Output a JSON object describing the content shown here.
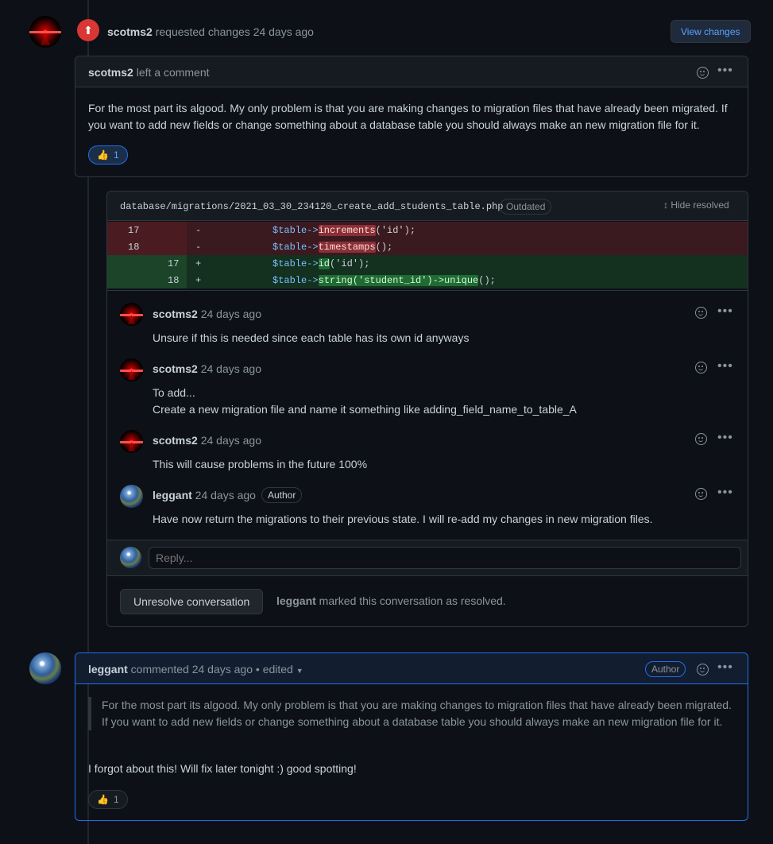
{
  "review": {
    "user": "scotms2",
    "action": "requested changes",
    "time": "24 days ago",
    "view_changes_label": "View changes",
    "comment_header_user": "scotms2",
    "comment_header_action": "left a comment",
    "body": "For the most part its algood. My only problem is that you are making changes to migration files that have already been migrated. If you want to add new fields or change something about a database table you should always make an new migration file for it.",
    "reaction_emoji": "👍",
    "reaction_count": "1"
  },
  "thread": {
    "file_path": "database/migrations/2021_03_30_234120_create_add_students_table.php",
    "outdated_label": "Outdated",
    "hide_resolved_label": "Hide resolved",
    "diff": [
      {
        "type": "del",
        "old": "17",
        "new": "",
        "sign": "-",
        "pre": "$table->",
        "hl": "increments",
        "post": "('id');"
      },
      {
        "type": "del",
        "old": "18",
        "new": "",
        "sign": "-",
        "pre": "$table->",
        "hl": "timestamps",
        "post": "();"
      },
      {
        "type": "add",
        "old": "",
        "new": "17",
        "sign": "+",
        "pre": "$table->",
        "hl": "id",
        "post": "('id');"
      },
      {
        "type": "add",
        "old": "",
        "new": "18",
        "sign": "+",
        "pre": "$table->",
        "hl": "string('student_id')->unique",
        "post": "();"
      }
    ],
    "comments": [
      {
        "user": "scotms2",
        "time": "24 days ago",
        "body": "Unsure if this is needed since each table has its own id anyways"
      },
      {
        "user": "scotms2",
        "time": "24 days ago",
        "body_line1": "To add...",
        "body_line2": "Create a new migration file and name it something like adding_field_name_to_table_A"
      },
      {
        "user": "scotms2",
        "time": "24 days ago",
        "body": "This will cause problems in the future 100%"
      },
      {
        "user": "leggant",
        "time": "24 days ago",
        "badge": "Author",
        "body": "Have now return the migrations to their previous state. I will re-add my changes in new migration files."
      }
    ],
    "reply_placeholder": "Reply...",
    "unresolve_label": "Unresolve conversation",
    "resolved_user": "leggant",
    "resolved_text": "marked this conversation as resolved."
  },
  "comment2": {
    "user": "leggant",
    "action": "commented",
    "time": "24 days ago",
    "edited": "• edited",
    "badge": "Author",
    "quote": "For the most part its algood. My only problem is that you are making changes to migration files that have already been migrated. If you want to add new fields or change something about a database table you should always make an new migration file for it.",
    "body": "I forgot about this! Will fix later tonight :) good spotting!",
    "reaction_emoji": "👍",
    "reaction_count": "1"
  }
}
